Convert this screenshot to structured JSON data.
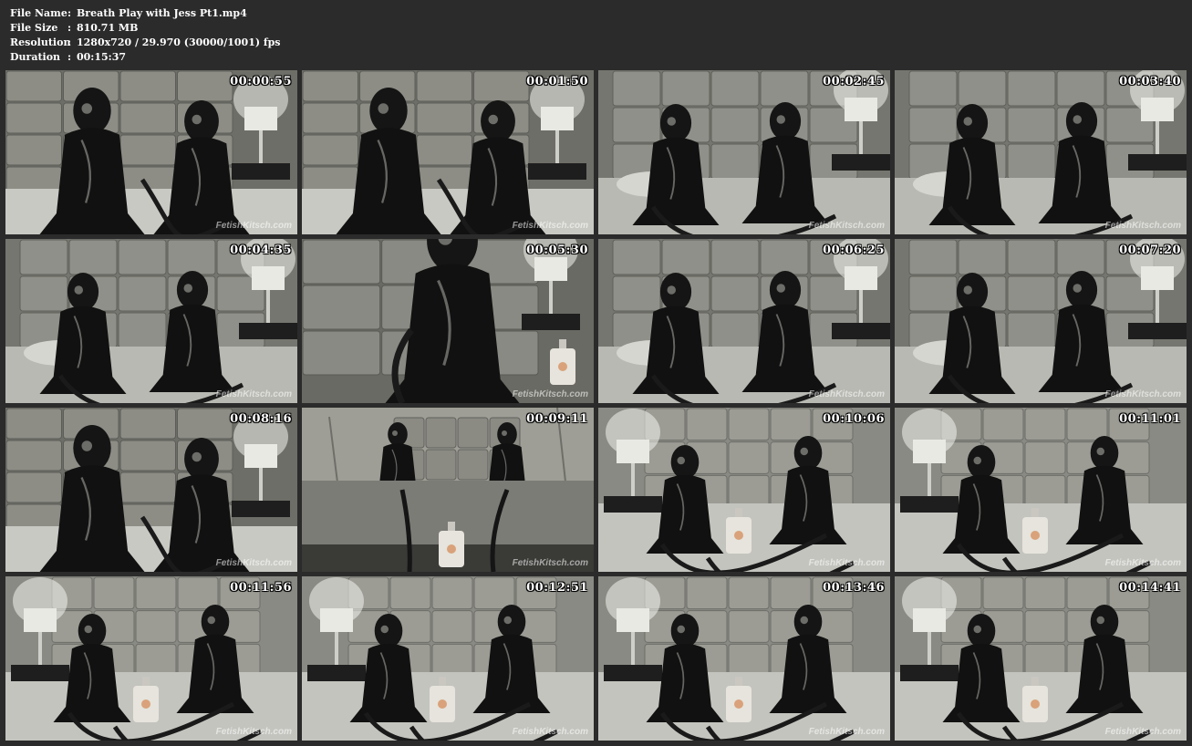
{
  "file_info": {
    "rows": [
      {
        "label": "File Name",
        "value": "Breath Play with Jess Pt1.mp4"
      },
      {
        "label": "File Size",
        "value": "810.71 MB"
      },
      {
        "label": "Resolution",
        "value": "1280x720 / 29.970 (30000/1001) fps"
      },
      {
        "label": "Duration",
        "value": "00:15:37"
      }
    ],
    "separator": ":"
  },
  "watermark": "FetishKitsch.com",
  "thumbnails": [
    {
      "timestamp": "00:00:55",
      "scene": "tall-wall"
    },
    {
      "timestamp": "00:01:50",
      "scene": "tall-wall"
    },
    {
      "timestamp": "00:02:45",
      "scene": "wall-bed"
    },
    {
      "timestamp": "00:03:40",
      "scene": "wall-bed"
    },
    {
      "timestamp": "00:04:35",
      "scene": "wall-bed"
    },
    {
      "timestamp": "00:05:30",
      "scene": "closeup"
    },
    {
      "timestamp": "00:06:25",
      "scene": "wall-bed"
    },
    {
      "timestamp": "00:07:20",
      "scene": "wall-bed"
    },
    {
      "timestamp": "00:08:16",
      "scene": "tall-wall"
    },
    {
      "timestamp": "00:09:11",
      "scene": "low-bed"
    },
    {
      "timestamp": "00:10:06",
      "scene": "bright-bed"
    },
    {
      "timestamp": "00:11:01",
      "scene": "bright-bed"
    },
    {
      "timestamp": "00:11:56",
      "scene": "bright-bed"
    },
    {
      "timestamp": "00:12:51",
      "scene": "bright-bed"
    },
    {
      "timestamp": "00:13:46",
      "scene": "bright-bed"
    },
    {
      "timestamp": "00:14:41",
      "scene": "bright-bed"
    }
  ]
}
